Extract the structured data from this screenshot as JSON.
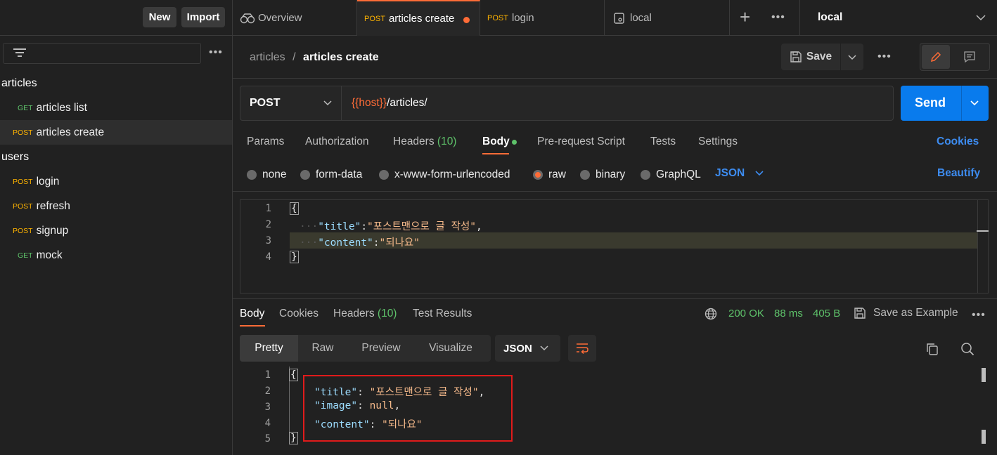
{
  "sidebar": {
    "new_label": "New",
    "import_label": "Import",
    "collections": [
      {
        "name": "articles",
        "requests": [
          {
            "method": "GET",
            "name": "articles list"
          },
          {
            "method": "POST",
            "name": "articles create"
          }
        ]
      },
      {
        "name": "users",
        "requests": [
          {
            "method": "POST",
            "name": "login"
          },
          {
            "method": "POST",
            "name": "refresh"
          },
          {
            "method": "POST",
            "name": "signup"
          },
          {
            "method": "GET",
            "name": "mock"
          }
        ]
      }
    ]
  },
  "tabs": [
    {
      "method": "",
      "label": "Overview"
    },
    {
      "method": "POST",
      "label": "articles create"
    },
    {
      "method": "POST",
      "label": "login"
    },
    {
      "method": "",
      "label": "local"
    }
  ],
  "environment": "local",
  "breadcrumb": {
    "collection": "articles",
    "separator": "/",
    "request": "articles create"
  },
  "save_label": "Save",
  "request": {
    "method": "POST",
    "url_var": "{{host}}",
    "url_path": "/articles/",
    "send_label": "Send"
  },
  "request_tabs": {
    "params": "Params",
    "authorization": "Authorization",
    "headers": "Headers",
    "headers_count": "(10)",
    "body": "Body",
    "prerequest": "Pre-request Script",
    "tests": "Tests",
    "settings": "Settings",
    "cookies": "Cookies"
  },
  "body_types": {
    "none": "none",
    "form_data": "form-data",
    "urlencoded": "x-www-form-urlencoded",
    "raw": "raw",
    "binary": "binary",
    "graphql": "GraphQL",
    "format": "JSON",
    "beautify": "Beautify"
  },
  "request_body": {
    "line_numbers": [
      "1",
      "2",
      "3",
      "4"
    ],
    "open_brace": "{",
    "close_brace": "}",
    "line2_key": "\"title\"",
    "line2_sep": ":",
    "line2_val": "\"포스트맨으로 글 작성\"",
    "line2_comma": ",",
    "line3_key": "\"content\"",
    "line3_sep": ":",
    "line3_val": "\"되나요\""
  },
  "response_tabs": {
    "body": "Body",
    "cookies": "Cookies",
    "headers": "Headers",
    "headers_count": "(10)",
    "test_results": "Test Results"
  },
  "response_status": {
    "status": "200 OK",
    "time": "88 ms",
    "size": "405 B",
    "save_example": "Save as Example"
  },
  "response_views": {
    "pretty": "Pretty",
    "raw": "Raw",
    "preview": "Preview",
    "visualize": "Visualize",
    "format": "JSON"
  },
  "response_body": {
    "line_numbers": [
      "1",
      "2",
      "3",
      "4",
      "5"
    ],
    "open_brace": "{",
    "close_brace": "}",
    "line2_key": "\"title\"",
    "line2_val": "\"포스트맨으로 글 작성\"",
    "line3_key": "\"image\"",
    "line3_val": "null",
    "line4_key": "\"content\"",
    "line4_val": "\"되나요\""
  },
  "colors": {
    "accent": "#ff6c37",
    "send": "#097bed",
    "get": "#5ec26a",
    "post": "#ffb400",
    "highlight_box": "#e01b1b"
  }
}
